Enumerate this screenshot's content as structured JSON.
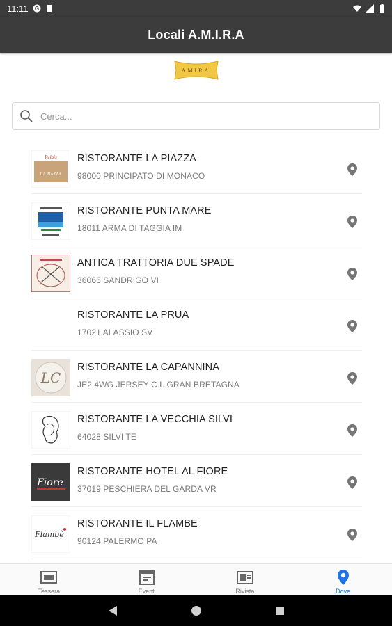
{
  "status_bar": {
    "time": "11:11"
  },
  "app_bar": {
    "title": "Locali A.M.I.R.A"
  },
  "logo": {
    "text": "A.M.I.R.A."
  },
  "search": {
    "placeholder": "Cerca...",
    "value": ""
  },
  "restaurants": [
    {
      "name": "RISTORANTE LA PIAZZA",
      "address": "98000  PRINCIPATO DI MONACO",
      "thumb": "la-piazza"
    },
    {
      "name": "RISTORANTE PUNTA MARE",
      "address": "18011 ARMA DI TAGGIA IM",
      "thumb": "punta-mare"
    },
    {
      "name": "ANTICA TRATTORIA DUE SPADE",
      "address": "36066 SANDRIGO VI",
      "thumb": "due-spade"
    },
    {
      "name": "RISTORANTE LA PRUA",
      "address": "17021 ALASSIO SV",
      "thumb": "none"
    },
    {
      "name": "RISTORANTE LA CAPANNINA",
      "address": "JE2 4WG JERSEY C.I. GRAN BRETAGNA",
      "thumb": "capannina"
    },
    {
      "name": "RISTORANTE LA VECCHIA SILVI",
      "address": "64028 SILVI TE",
      "thumb": "vecchia-silvi"
    },
    {
      "name": "RISTORANTE HOTEL AL FIORE",
      "address": "37019 PESCHIERA DEL GARDA VR",
      "thumb": "al-fiore"
    },
    {
      "name": "RISTORANTE IL FLAMBE",
      "address": "90124 PALERMO PA",
      "thumb": "flambe"
    }
  ],
  "bottom_nav": [
    {
      "label": "Tessera",
      "icon": "card-icon",
      "active": false
    },
    {
      "label": "Eventi",
      "icon": "calendar-icon",
      "active": false
    },
    {
      "label": "Rivista",
      "icon": "magazine-icon",
      "active": false
    },
    {
      "label": "Dove",
      "icon": "location-pin-icon",
      "active": true
    }
  ],
  "colors": {
    "app_bar": "#3c3c3c",
    "accent": "#1a73e8",
    "logo_gold": "#f2c744",
    "pin_gray": "#757575"
  }
}
